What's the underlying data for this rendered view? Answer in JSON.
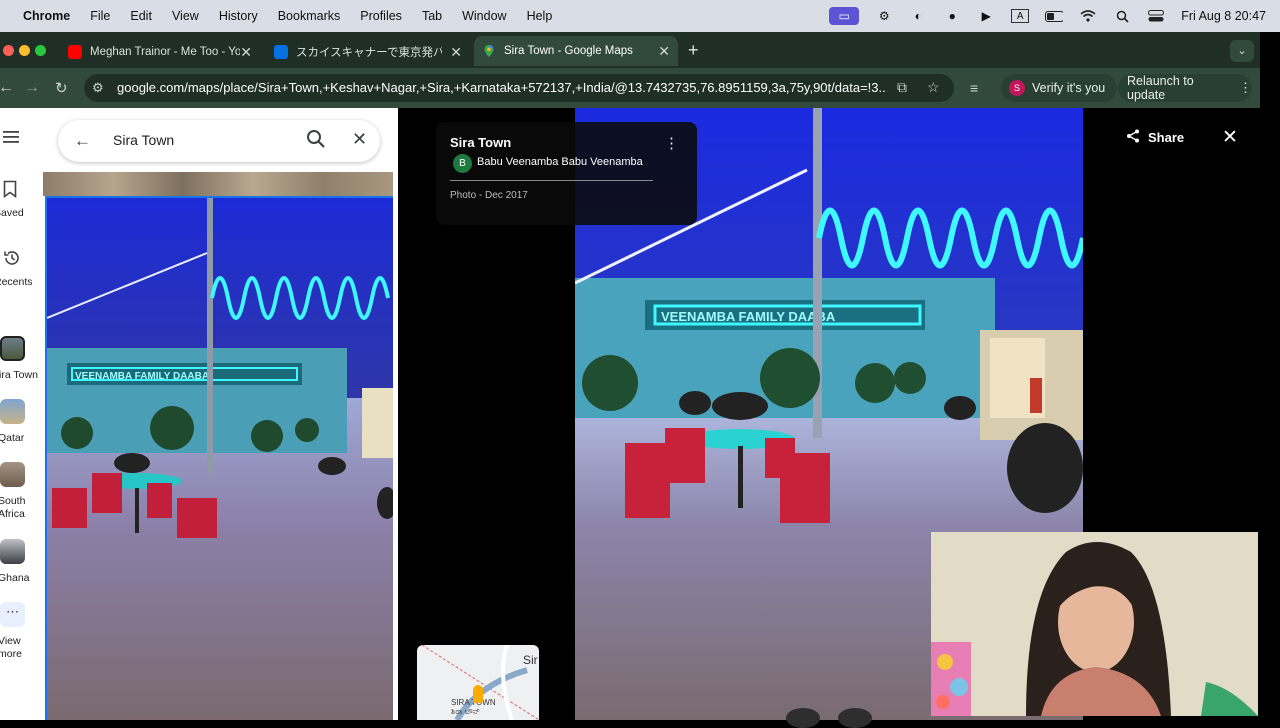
{
  "menubar": {
    "items": [
      "Chrome",
      "File",
      "Edit",
      "View",
      "History",
      "Bookmarks",
      "Profiles",
      "Tab",
      "Window",
      "Help"
    ],
    "datetime": "Fri Aug 8  20:47"
  },
  "tabs": [
    {
      "title": "Meghan Trainor - Me Too - Yo",
      "favicon": "youtube-icon"
    },
    {
      "title": "スカイスキャナーで東京発バンコク",
      "favicon": "skyscanner-icon"
    },
    {
      "title": "Sira Town - Google Maps",
      "favicon": "maps-pin-icon",
      "active": true
    }
  ],
  "toolbar": {
    "url": "google.com/maps/place/Sira+Town,+Keshav+Nagar,+Sira,+Karnataka+572137,+India/@13.7432735,76.8951159,3a,75y,90t/data=!3...",
    "verify_label": "Verify it's you",
    "verify_avatar": "S",
    "relaunch_label": "Relaunch to update"
  },
  "rail": {
    "saved": "Saved",
    "recents": "Recents",
    "recent_places": [
      "Sira Town",
      "Qatar",
      "South Africa",
      "Ghana"
    ],
    "view_more": "View more"
  },
  "search": {
    "value": "Sira Town"
  },
  "viewer": {
    "place_name": "Sira Town",
    "author_initial": "B",
    "author": "Babu Veenamba Babu Veenamba",
    "photo_meta": "Photo - Dec 2017",
    "share_label": "Share",
    "sign_text": "VEENAMBA FAMILY DAABA"
  },
  "minimap": {
    "label_primary": "SIRA TOWN",
    "label_local": "ಶಿರಾ ಟೌನ್",
    "label_edge": "Sir"
  },
  "colors": {
    "tab_strip": "#1f2f26",
    "toolbar": "#324a3b",
    "maps_blue": "#1a73e8",
    "neon": "#37e8ff",
    "chair_red": "#d0243a"
  }
}
